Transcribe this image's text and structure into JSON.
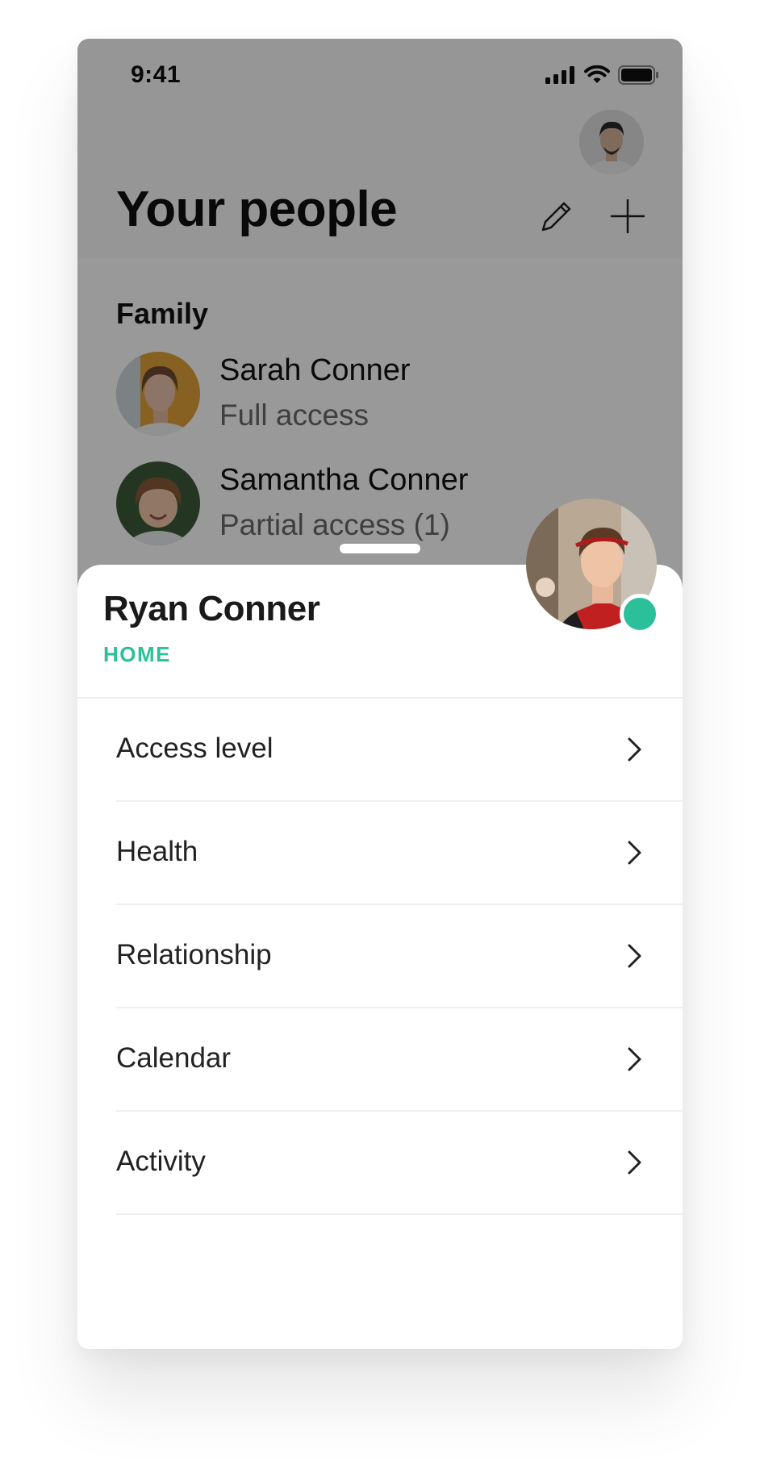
{
  "status_bar": {
    "time": "9:41"
  },
  "header": {
    "title": "Your people",
    "edit_icon": "pencil-icon",
    "add_icon": "plus-icon"
  },
  "family": {
    "title": "Family",
    "people": [
      {
        "name": "Sarah Conner",
        "access": "Full access"
      },
      {
        "name": "Samantha Conner",
        "access": "Partial access (1)"
      }
    ]
  },
  "sheet": {
    "name": "Ryan Conner",
    "location": "HOME",
    "status_color": "#2cc09a",
    "items": [
      {
        "label": "Access level",
        "icon": "chevron-right-icon"
      },
      {
        "label": "Health",
        "icon": "chevron-right-icon"
      },
      {
        "label": "Relationship",
        "icon": "chevron-right-icon"
      },
      {
        "label": "Calendar",
        "icon": "chevron-right-icon"
      },
      {
        "label": "Activity",
        "icon": "chevron-right-icon"
      }
    ]
  },
  "colors": {
    "accent": "#2cc09a",
    "text": "#111111",
    "secondary_text": "#6a6a6a"
  }
}
